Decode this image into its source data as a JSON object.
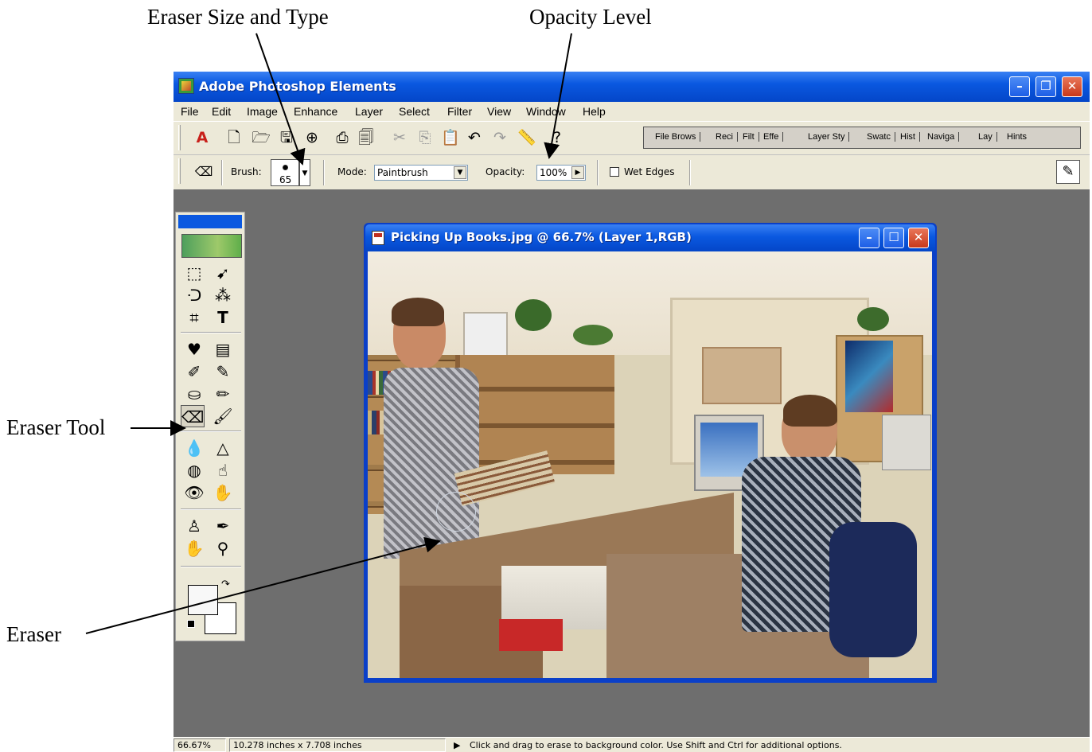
{
  "callouts": {
    "eraser_size": "Eraser Size and Type",
    "opacity": "Opacity Level",
    "eraser_tool": "Eraser Tool",
    "eraser": "Eraser"
  },
  "app": {
    "title": "Adobe Photoshop Elements",
    "menu": [
      "File",
      "Edit",
      "Image",
      "Enhance",
      "Layer",
      "Select",
      "Filter",
      "View",
      "Window",
      "Help"
    ],
    "palette_tabs": [
      "File Brows",
      "Reci",
      "Filt",
      "Effe",
      "Layer Sty",
      "Swatc",
      "Hist",
      "Naviga",
      "Lay",
      "Hints"
    ]
  },
  "options": {
    "brush_label": "Brush:",
    "brush_size": "65",
    "mode_label": "Mode:",
    "mode_value": "Paintbrush",
    "opacity_label": "Opacity:",
    "opacity_value": "100%",
    "wet_edges_label": "Wet Edges"
  },
  "document": {
    "title": "Picking Up Books.jpg @ 66.7% (Layer 1,RGB)"
  },
  "status": {
    "zoom": "66.67%",
    "size": "10.278 inches x 7.708 inches",
    "message": "Click and drag to erase to background color.  Use Shift and Ctrl for additional options."
  },
  "icons": {
    "toolbar": [
      "adobe-logo-icon",
      "new-file-icon",
      "open-file-icon",
      "save-icon",
      "save-web-icon",
      "print-icon",
      "print-preview-icon",
      "cut-icon",
      "copy-icon",
      "paste-icon",
      "undo-icon",
      "redo-icon",
      "ruler-icon",
      "help-icon"
    ]
  },
  "colors": {
    "titlebar": "#0a58e0",
    "workspace": "#6e6e6e",
    "chrome": "#ece9d8"
  }
}
